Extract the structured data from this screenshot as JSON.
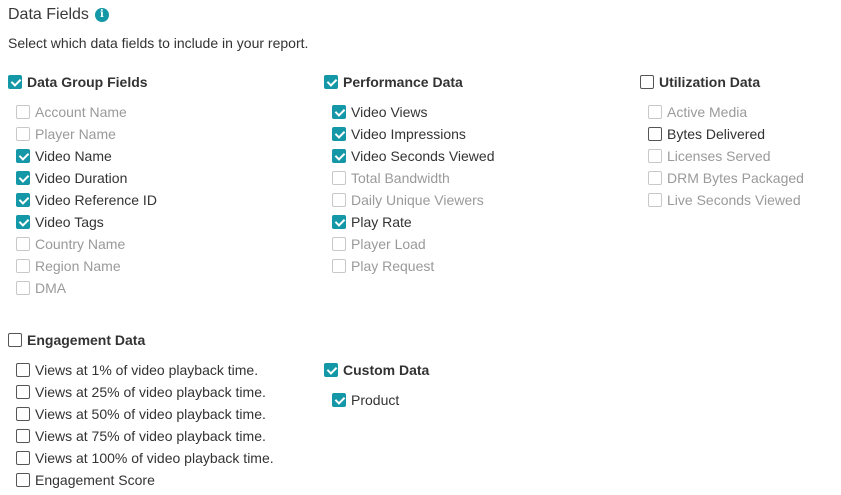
{
  "header": {
    "title": "Data Fields",
    "info_icon": "i"
  },
  "subtitle": "Select which data fields to include in your report.",
  "colors": {
    "accent": "#1497a6",
    "disabled_text": "#9a9a9a"
  },
  "groups": {
    "data_group": {
      "label": "Data Group Fields",
      "checked": true,
      "items": [
        {
          "label": "Account Name",
          "state": "disabled"
        },
        {
          "label": "Player Name",
          "state": "disabled"
        },
        {
          "label": "Video Name",
          "state": "checked"
        },
        {
          "label": "Video Duration",
          "state": "checked"
        },
        {
          "label": "Video Reference ID",
          "state": "checked"
        },
        {
          "label": "Video Tags",
          "state": "checked"
        },
        {
          "label": "Country Name",
          "state": "disabled"
        },
        {
          "label": "Region Name",
          "state": "disabled"
        },
        {
          "label": "DMA",
          "state": "disabled"
        }
      ]
    },
    "performance": {
      "label": "Performance Data",
      "checked": true,
      "items": [
        {
          "label": "Video Views",
          "state": "checked"
        },
        {
          "label": "Video Impressions",
          "state": "checked"
        },
        {
          "label": "Video Seconds Viewed",
          "state": "checked"
        },
        {
          "label": "Total Bandwidth",
          "state": "disabled"
        },
        {
          "label": "Daily Unique Viewers",
          "state": "disabled"
        },
        {
          "label": "Play Rate",
          "state": "checked"
        },
        {
          "label": "Player Load",
          "state": "disabled"
        },
        {
          "label": "Play Request",
          "state": "disabled"
        }
      ]
    },
    "utilization": {
      "label": "Utilization Data",
      "checked": false,
      "items": [
        {
          "label": "Active Media",
          "state": "disabled"
        },
        {
          "label": "Bytes Delivered",
          "state": "unchecked"
        },
        {
          "label": "Licenses Served",
          "state": "disabled"
        },
        {
          "label": "DRM Bytes Packaged",
          "state": "disabled"
        },
        {
          "label": "Live Seconds Viewed",
          "state": "disabled"
        }
      ]
    },
    "engagement": {
      "label": "Engagement Data",
      "checked": false,
      "items": [
        {
          "label": "Views at 1% of video playback time.",
          "state": "unchecked"
        },
        {
          "label": "Views at 25% of video playback time.",
          "state": "unchecked"
        },
        {
          "label": "Views at 50% of video playback time.",
          "state": "unchecked"
        },
        {
          "label": "Views at 75% of video playback time.",
          "state": "unchecked"
        },
        {
          "label": "Views at 100% of video playback time.",
          "state": "unchecked"
        },
        {
          "label": "Engagement Score",
          "state": "unchecked"
        }
      ]
    },
    "custom": {
      "label": "Custom Data",
      "checked": true,
      "items": [
        {
          "label": "Product",
          "state": "checked"
        }
      ]
    }
  }
}
